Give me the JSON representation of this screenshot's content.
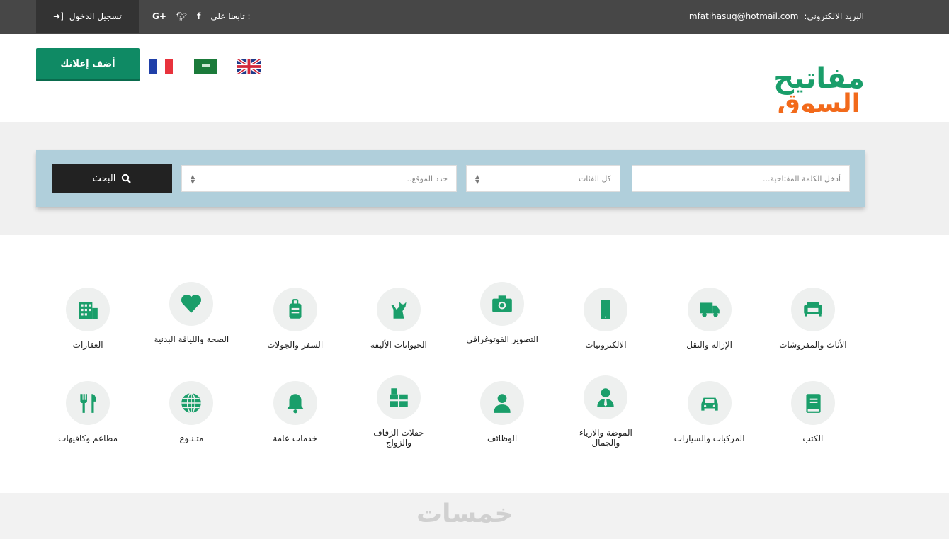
{
  "topbar": {
    "login_label": "تسجيل الدخول",
    "follow_label": "تابعنا على :",
    "email_label": "البريد الالكتروني:",
    "email_value": "mfatihasuq@hotmail.com"
  },
  "header": {
    "add_ad_label": "أضف إعلانك",
    "logo_text": "مفاتيح السوق"
  },
  "search": {
    "keyword_placeholder": "أدخل الكلمة المفتاحية...",
    "category_value": "كل الفئات",
    "location_placeholder": "حدد الموقع..",
    "button_label": "البحث"
  },
  "categories": [
    {
      "label": "الأثاث والمفروشات",
      "icon": "sofa"
    },
    {
      "label": "الإزالة والنقل",
      "icon": "truck"
    },
    {
      "label": "الالكترونيات",
      "icon": "mobile"
    },
    {
      "label": "التصوير الفوتوغرافي",
      "icon": "camera"
    },
    {
      "label": "الحيوانات الأليفة",
      "icon": "cat"
    },
    {
      "label": "السفر والجولات",
      "icon": "suitcase"
    },
    {
      "label": "الصحة واللياقة البدنية",
      "icon": "heart"
    },
    {
      "label": "العقارات",
      "icon": "building"
    },
    {
      "label": "الكتب",
      "icon": "book"
    },
    {
      "label": "المركبات والسيارات",
      "icon": "car"
    },
    {
      "label": "الموضة والازياء والجمال",
      "icon": "user-tie"
    },
    {
      "label": "الوظائف",
      "icon": "user"
    },
    {
      "label": "حفلات الزفاف والزواج",
      "icon": "gift"
    },
    {
      "label": "خدمات عامة",
      "icon": "bell"
    },
    {
      "label": "متـنـوع",
      "icon": "globe"
    },
    {
      "label": "مطاعم وكافيهات",
      "icon": "utensils"
    }
  ],
  "footer": {
    "watermark": "خمسات"
  },
  "colors": {
    "accent": "#0f8a64",
    "icon": "#1a9e6a",
    "topbar": "#474747"
  }
}
